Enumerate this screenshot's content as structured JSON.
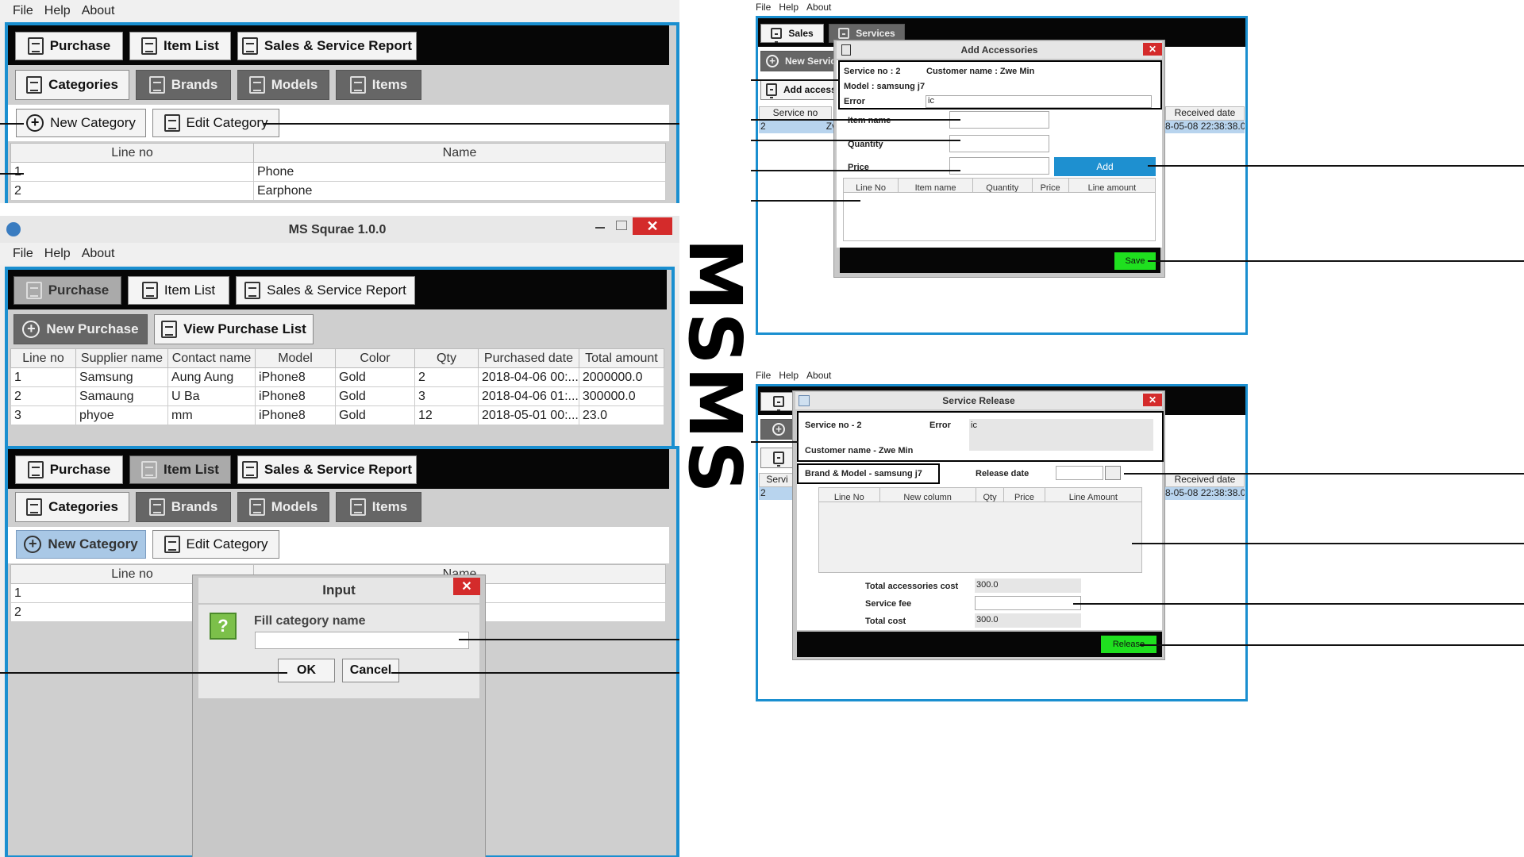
{
  "title": "MSMS",
  "menu": {
    "file": "File",
    "help": "Help",
    "about": "About"
  },
  "app": {
    "window_title": "MS Squrae 1.0.0"
  },
  "nav": {
    "purchase": "Purchase",
    "item_list": "Item List",
    "report": "Sales & Service Report"
  },
  "category_tabs": {
    "categories": "Categories",
    "brands": "Brands",
    "models": "Models",
    "items": "Items"
  },
  "category_actions": {
    "new": "New Category",
    "edit": "Edit Category"
  },
  "category_table": {
    "headers": [
      "Line no",
      "Name"
    ],
    "rows": [
      [
        "1",
        "Phone"
      ],
      [
        "2",
        "Earphone"
      ]
    ]
  },
  "purchase_actions": {
    "new": "New Purchase",
    "view": "View Purchase List"
  },
  "purchase_table": {
    "headers": [
      "Line no",
      "Supplier name",
      "Contact name",
      "Model",
      "Color",
      "Qty",
      "Purchased date",
      "Total amount"
    ],
    "rows": [
      [
        "1",
        "Samsung",
        "Aung Aung",
        "iPhone8",
        "Gold",
        "2",
        "2018-04-06 00:...",
        "2000000.0"
      ],
      [
        "2",
        "Samaung",
        "U Ba",
        "iPhone8",
        "Gold",
        "3",
        "2018-04-06 01:...",
        "300000.0"
      ],
      [
        "3",
        "phyoe",
        "mm",
        "iPhone8",
        "Gold",
        "12",
        "2018-05-01 00:...",
        "23.0"
      ]
    ]
  },
  "category_table2": {
    "headers": [
      "Line no",
      "Name"
    ],
    "rows": [
      [
        "1"
      ],
      [
        "2"
      ]
    ]
  },
  "input_dialog": {
    "title": "Input",
    "prompt": "Fill category name",
    "ok": "OK",
    "cancel": "Cancel",
    "icon": "?"
  },
  "sales_tabs": {
    "sales": "Sales",
    "services": "Services"
  },
  "service_bg": {
    "new_service": "New Servic",
    "add_access": "Add access",
    "service_no": "Service no",
    "row_no": "2",
    "row_cust": "Zv",
    "received_date": "Received date",
    "received_value": "8-05-08 22:38:38.0"
  },
  "add_accessories": {
    "title": "Add Accessories",
    "service_no": "Service no : 2",
    "customer": "Customer name :  Zwe Min",
    "model": "Model :  samsung j7",
    "error_label": "Error",
    "error_value": "ic",
    "item_name": "Item name",
    "quantity": "Quantity",
    "price": "Price",
    "add": "Add",
    "headers": [
      "Line No",
      "Item name",
      "Quantity",
      "Price",
      "Line amount"
    ],
    "save": "Save"
  },
  "service_release": {
    "title": "Service Release",
    "service_no": "Service no -  2",
    "error_label": "Error",
    "error_value": "ic",
    "customer": "Customer name -  Zwe Min",
    "brand_model": "Brand & Model -  samsung j7",
    "release_date": "Release date",
    "headers": [
      "Line No",
      "New column",
      "Qty",
      "Price",
      "Line Amount"
    ],
    "total_accessories_label": "Total accessories cost",
    "total_accessories_value": "300.0",
    "service_fee_label": "Service fee",
    "total_cost_label": "Total cost",
    "total_cost_value": "300.0",
    "release": "Release",
    "bg_service": "Servi",
    "bg_row": "2",
    "received_date": "Received date",
    "received_value": "8-05-08 22:38:38.0"
  },
  "colors": {
    "accent": "#1a8fd0",
    "green": "#1fe01f",
    "blue_button": "#1e90d0",
    "close_red": "#d42b2b"
  }
}
